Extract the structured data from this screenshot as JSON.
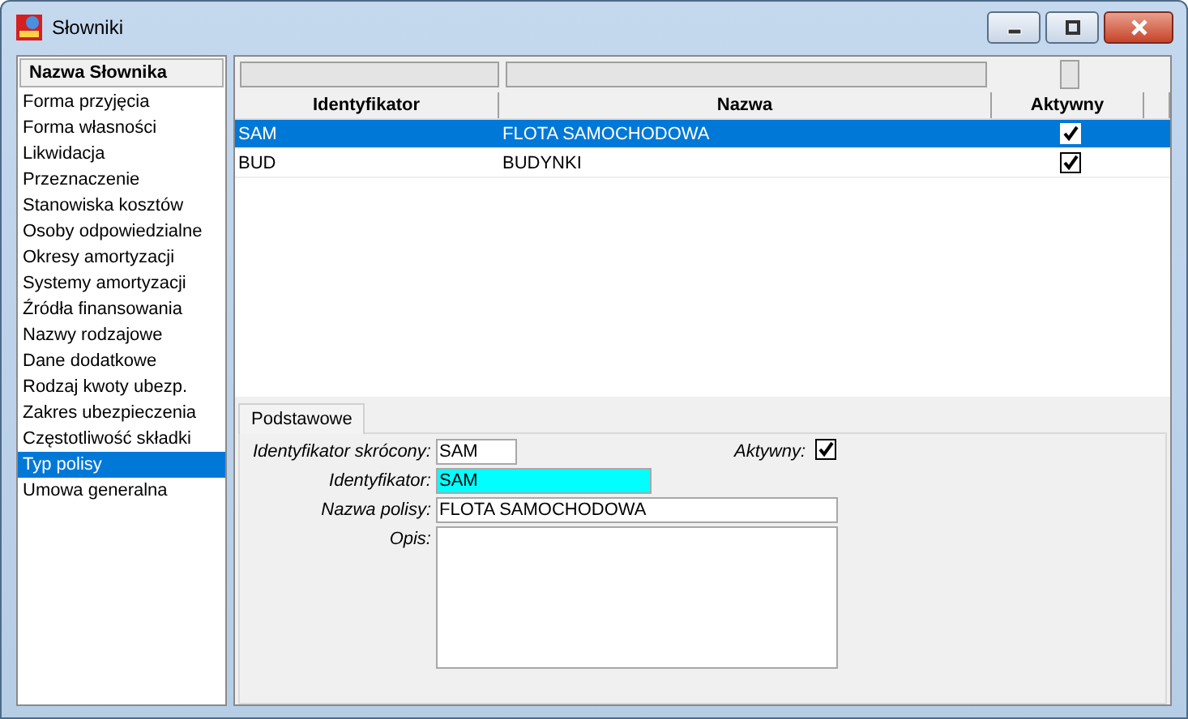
{
  "window": {
    "title": "Słowniki"
  },
  "sidebar": {
    "header": "Nazwa Słownika",
    "items": [
      {
        "label": "Forma przyjęcia",
        "selected": false
      },
      {
        "label": "Forma własności",
        "selected": false
      },
      {
        "label": "Likwidacja",
        "selected": false
      },
      {
        "label": "Przeznaczenie",
        "selected": false
      },
      {
        "label": "Stanowiska kosztów",
        "selected": false
      },
      {
        "label": "Osoby odpowiedzialne",
        "selected": false
      },
      {
        "label": "Okresy amortyzacji",
        "selected": false
      },
      {
        "label": "Systemy amortyzacji",
        "selected": false
      },
      {
        "label": "Źródła finansowania",
        "selected": false
      },
      {
        "label": "Nazwy rodzajowe",
        "selected": false
      },
      {
        "label": "Dane dodatkowe",
        "selected": false
      },
      {
        "label": "Rodzaj kwoty ubezp.",
        "selected": false
      },
      {
        "label": "Zakres ubezpieczenia",
        "selected": false
      },
      {
        "label": "Częstotliwość składki",
        "selected": false
      },
      {
        "label": "Typ polisy",
        "selected": true
      },
      {
        "label": "Umowa generalna",
        "selected": false
      }
    ]
  },
  "table": {
    "columns": [
      "Identyfikator",
      "Nazwa",
      "Aktywny"
    ],
    "rows": [
      {
        "identyfikator": "SAM",
        "nazwa": "FLOTA SAMOCHODOWA",
        "aktywny": true,
        "selected": true
      },
      {
        "identyfikator": "BUD",
        "nazwa": "BUDYNKI",
        "aktywny": true,
        "selected": false
      }
    ]
  },
  "tabs": [
    {
      "label": "Podstawowe",
      "selected": true
    }
  ],
  "form": {
    "rows": [
      [
        {
          "kind": "text",
          "label": "Identyfikator skrócony:",
          "value": "SAM",
          "highlighted": false
        },
        {
          "kind": "checkbox",
          "label": "Aktywny:",
          "checked": true
        }
      ],
      [
        {
          "kind": "text",
          "label": "Identyfikator:",
          "value": "SAM",
          "highlighted": true
        }
      ],
      [
        {
          "kind": "text",
          "label": "Nazwa polisy:",
          "value": "FLOTA SAMOCHODOWA",
          "highlighted": false
        }
      ],
      [
        {
          "kind": "textarea",
          "label": "Opis:"
        }
      ]
    ]
  }
}
